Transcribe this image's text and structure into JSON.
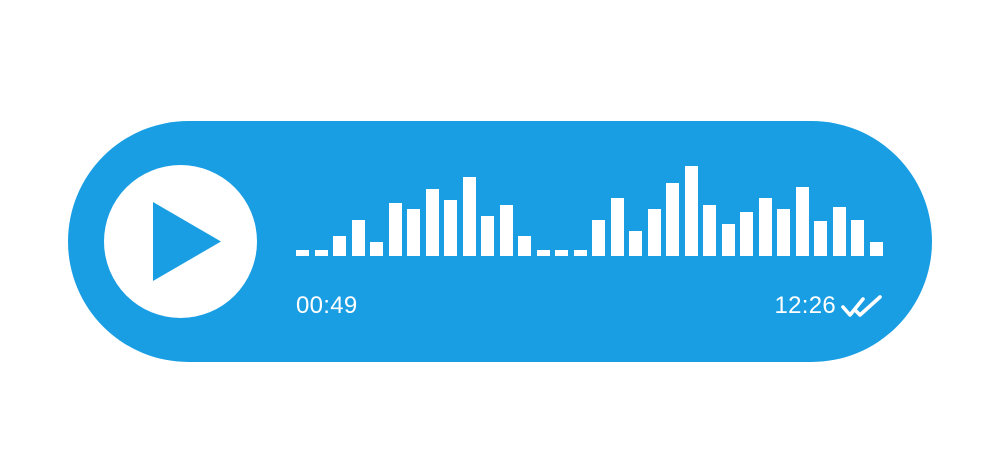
{
  "message": {
    "elapsed_time": "00:49",
    "sent_time": "12:26",
    "read_status_icon": "double-check-icon",
    "play_icon": "play-icon",
    "waveform_levels": [
      0.06,
      0.06,
      0.21,
      0.38,
      0.15,
      0.55,
      0.49,
      0.7,
      0.58,
      0.82,
      0.42,
      0.53,
      0.21,
      0.06,
      0.06,
      0.06,
      0.38,
      0.6,
      0.26,
      0.49,
      0.76,
      0.94,
      0.53,
      0.33,
      0.46,
      0.6,
      0.49,
      0.72,
      0.36,
      0.51,
      0.38,
      0.15
    ]
  },
  "colors": {
    "bubble": "#1a9ee3",
    "foreground": "#ffffff"
  }
}
